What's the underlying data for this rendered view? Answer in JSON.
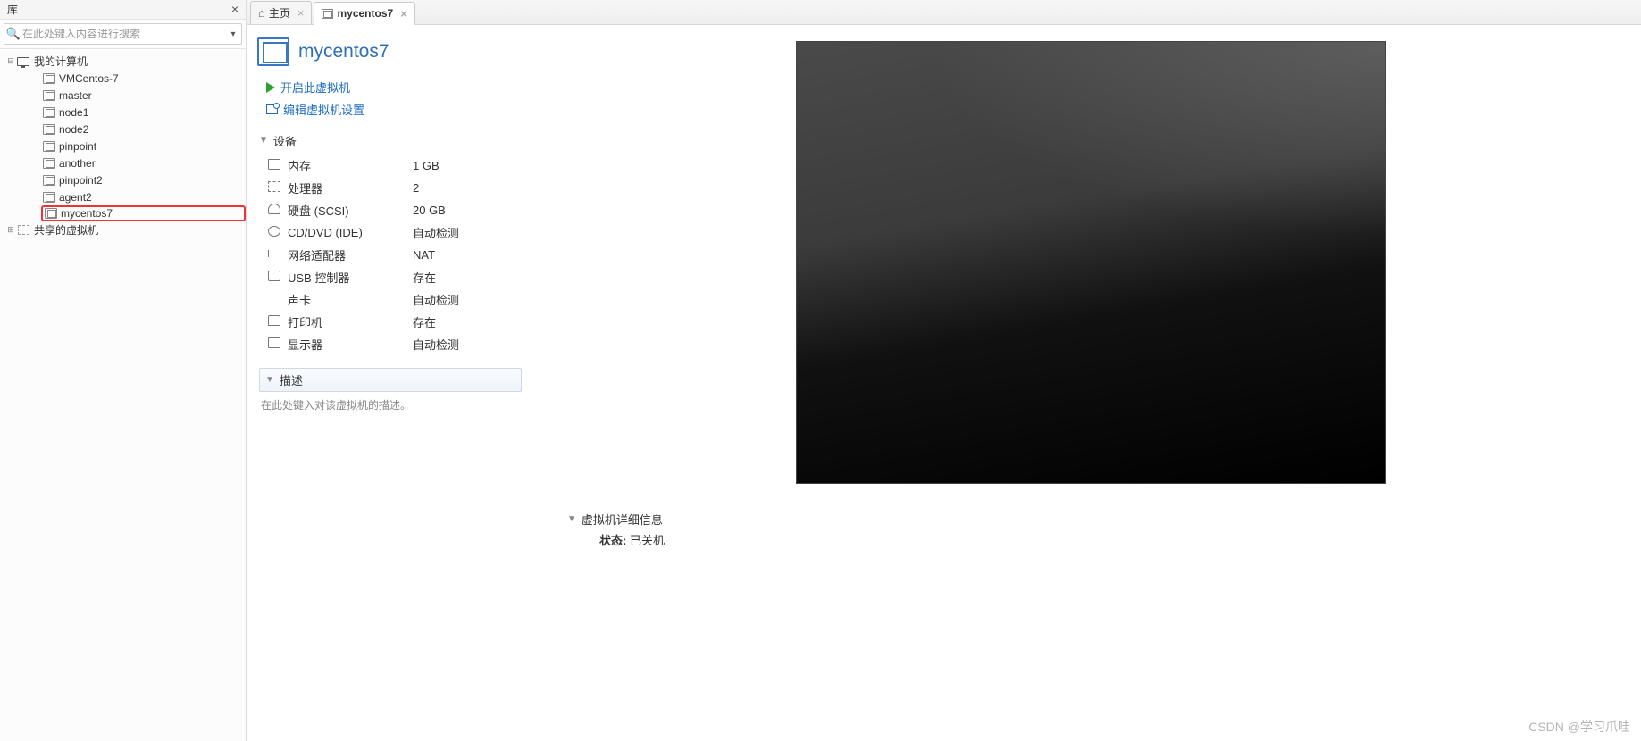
{
  "sidebar": {
    "title": "库",
    "search_placeholder": "在此处键入内容进行搜索",
    "root": {
      "label": "我的计算机"
    },
    "items": [
      {
        "label": "VMCentos-7"
      },
      {
        "label": "master"
      },
      {
        "label": "node1"
      },
      {
        "label": "node2"
      },
      {
        "label": "pinpoint"
      },
      {
        "label": "another"
      },
      {
        "label": "pinpoint2"
      },
      {
        "label": "agent2"
      },
      {
        "label": "mycentos7"
      }
    ],
    "shared": {
      "label": "共享的虚拟机"
    }
  },
  "tabs": {
    "home": "主页",
    "current": "mycentos7"
  },
  "vm": {
    "title": "mycentos7",
    "start_label": "开启此虚拟机",
    "edit_label": "编辑虚拟机设置"
  },
  "sections": {
    "devices": "设备",
    "description": "描述",
    "detail": "虚拟机详细信息"
  },
  "devices": [
    {
      "name": "内存",
      "value": "1 GB",
      "cls": "mem"
    },
    {
      "name": "处理器",
      "value": "2",
      "cls": "cpu"
    },
    {
      "name": "硬盘 (SCSI)",
      "value": "20 GB",
      "cls": "disk"
    },
    {
      "name": "CD/DVD (IDE)",
      "value": "自动检测",
      "cls": "cd"
    },
    {
      "name": "网络适配器",
      "value": "NAT",
      "cls": "net"
    },
    {
      "name": "USB 控制器",
      "value": "存在",
      "cls": "usb"
    },
    {
      "name": "声卡",
      "value": "自动检测",
      "cls": "sound"
    },
    {
      "name": "打印机",
      "value": "存在",
      "cls": "printer"
    },
    {
      "name": "显示器",
      "value": "自动检测",
      "cls": "display"
    }
  ],
  "description_placeholder": "在此处键入对该虚拟机的描述。",
  "status": {
    "label": "状态:",
    "value": "已关机"
  },
  "watermark": "CSDN @学习爪哇"
}
